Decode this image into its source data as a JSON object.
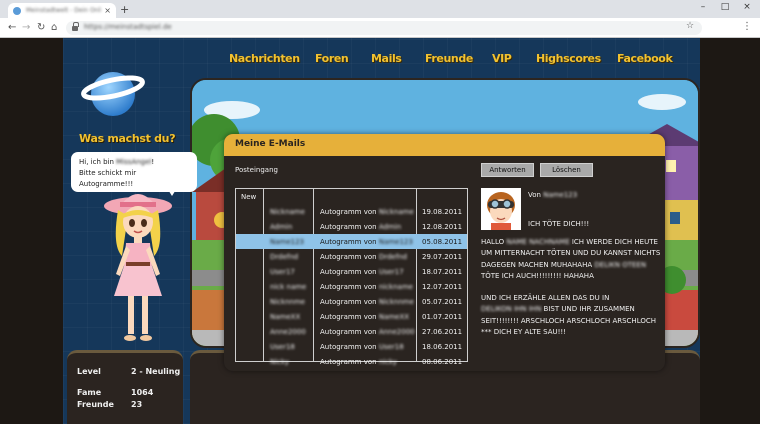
{
  "browser": {
    "tab_title": "Meinstadtwelt - Dein Online-Game",
    "url": "https://meinstadtspiel.de",
    "new_tab_label": "+",
    "tab_close": "×",
    "minimize": "–",
    "maximize": "□",
    "close": "×"
  },
  "nav": [
    "Nachrichten",
    "Foren",
    "Mails",
    "Freunde",
    "VIP",
    "Highscores",
    "Facebook"
  ],
  "sidebar": {
    "question": "Was machst du?",
    "status_line1_prefix": "Hi, ich bin ",
    "status_line1_name": "MissAngel",
    "status_line1_suffix": "!",
    "status_line2": "Bitte schickt mir Autogramme!!!",
    "stats": [
      {
        "label": "Level",
        "value": "2 - Neuling"
      },
      {
        "label": "Fame",
        "value": "1064"
      },
      {
        "label": "Freunde",
        "value": "23"
      }
    ]
  },
  "mail": {
    "title": "Meine E-Mails",
    "folder": "Posteingang",
    "reply_label": "Antworten",
    "delete_label": "Löschen",
    "new_header": "New",
    "rows": [
      {
        "from": "Nickname",
        "subject_prefix": "Autogramm von",
        "subject_name": "Nickname",
        "date": "19.08.2011"
      },
      {
        "from": "Admin",
        "subject_prefix": "Autogramm von",
        "subject_name": "Admin",
        "date": "12.08.2011"
      },
      {
        "from": "Name123",
        "subject_prefix": "Autogramm von",
        "subject_name": "Name123",
        "date": "05.08.2011"
      },
      {
        "from": "Drdefnd",
        "subject_prefix": "Autogramm von",
        "subject_name": "Drdefnd",
        "date": "29.07.2011"
      },
      {
        "from": "User17",
        "subject_prefix": "Autogramm von",
        "subject_name": "User17",
        "date": "18.07.2011"
      },
      {
        "from": "nick name",
        "subject_prefix": "Autogramm von",
        "subject_name": "nickname",
        "date": "12.07.2011"
      },
      {
        "from": "Nicknnme",
        "subject_prefix": "Autogramm von",
        "subject_name": "Nicknnme",
        "date": "05.07.2011"
      },
      {
        "from": "NameXX",
        "subject_prefix": "Autogramm von",
        "subject_name": "NameXX",
        "date": "01.07.2011"
      },
      {
        "from": "Anne2000",
        "subject_prefix": "Autogramm von",
        "subject_name": "Anne2000",
        "date": "27.06.2011"
      },
      {
        "from": "User18",
        "subject_prefix": "Autogramm von",
        "subject_name": "User18",
        "date": "18.06.2011"
      },
      {
        "from": "Nicky",
        "subject_prefix": "Autogramm von",
        "subject_name": "nicky",
        "date": "08.06.2011"
      }
    ],
    "selected_index": 2,
    "reader": {
      "from_label": "Von",
      "from_name": "Name123",
      "subject": "ICH TÖTE DICH!!!",
      "p1_a": "HALLO",
      "p1_name": "NAME NACHNAME",
      "p1_b": "ICH WERDE DICH HEUTE UM MITTERNACHT TÖTEN UND DU KANNST NICHTS DAGEGEN MACHEN MUHAHAHA",
      "p1_name2": "DELIKN OTEEN",
      "p1_c": "TÖTE ICH AUCH!!!!!!!!! HAHAHA",
      "p2_a": "UND ICH ERZÄHLE ALLEN DAS DU IN",
      "p2_name": "DELIKON IHN IHN",
      "p2_b": "BIST UND IHR ZUSAMMEN SEIT!!!!!!!! ARSCHLOCH ARSCHLOCH ARSCHLOCH *** DICH EY ALTE SAU!!!"
    }
  },
  "colors": {
    "accent_gold": "#f2c230",
    "titlebar": "#e6b03a",
    "selected_row": "#8fc3e8"
  }
}
